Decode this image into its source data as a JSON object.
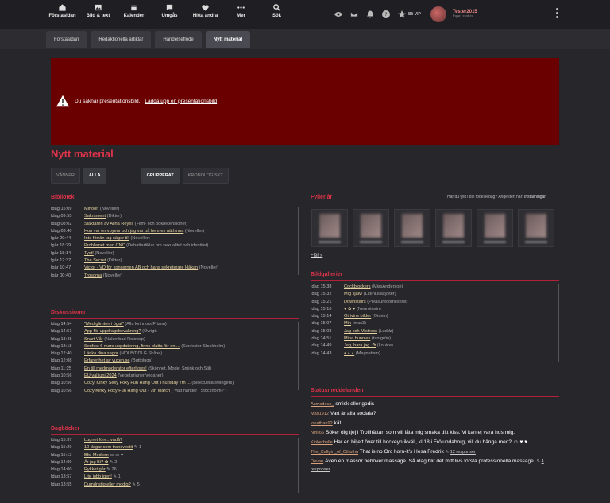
{
  "nav": [
    {
      "label": "Förstasidan",
      "icon": "home-icon"
    },
    {
      "label": "Bild & text",
      "icon": "image-icon"
    },
    {
      "label": "Kalender",
      "icon": "calendar-icon"
    },
    {
      "label": "Umgås",
      "icon": "chat-icon"
    },
    {
      "label": "Hitta andra",
      "icon": "heart-icon"
    },
    {
      "label": "Mer",
      "icon": "more-dots-icon"
    },
    {
      "label": "Sök",
      "icon": "search-icon"
    }
  ],
  "top": {
    "vip_label": "Bli VIP",
    "user_name": "Tester2015",
    "user_status": "Inget status..."
  },
  "tabs": [
    "Förstasidan",
    "Redaktionella artiklar",
    "Händelseflöde",
    "Nytt material"
  ],
  "banner": {
    "text": "Du saknar presentationsbild.",
    "link": "Ladda upp en presentationsbild"
  },
  "page_title": "Nytt material",
  "filters": {
    "friends": "VÄNNER",
    "all": "ALLA",
    "grouped": "GRUPPERAT",
    "chrono": "KRONOLOGISKT"
  },
  "bibliotek": {
    "title": "Bibliotek",
    "rows": [
      {
        "t": "Idag 15:09",
        "link": "Miftoon",
        "meta": "(Noveller)"
      },
      {
        "t": "Idag 09:55",
        "link": "Sakrament",
        "meta": "(Dikter)"
      },
      {
        "t": "Idag 08:02",
        "link": "Slaktaren av Alina Reyes",
        "meta": "(Film- och bokrecensioner)"
      },
      {
        "t": "Idag 03:40",
        "link": "Hon var en voyeur och jag var på hennes näthinna",
        "meta": "(Noveller)"
      },
      {
        "t": "Igår 20:44",
        "link": "Inte förrän jag säger till",
        "meta": "(Noveller)"
      },
      {
        "t": "Igår 18:29",
        "link": "Problemet med CNC",
        "meta": "(Debattartiklar om sexualitet och identitet)"
      },
      {
        "t": "Igår 18:14",
        "link": "Tyst!",
        "meta": "(Noveller)"
      },
      {
        "t": "Igår 12:37",
        "link": "The Secret",
        "meta": "(Dikter)"
      },
      {
        "t": "Igår 10:47",
        "link": "Victor - VD för koncernen AB och hans sekreterare Håkan",
        "meta": "(Noveller)"
      },
      {
        "t": "Igår 00:40",
        "link": "Trosorna",
        "meta": "(Noveller)"
      }
    ]
  },
  "diskussioner": {
    "title": "Diskussioner",
    "rows": [
      {
        "t": "Idag 14:54",
        "link": "\"Med glimten i ögat\"",
        "meta": "(Alla kvinnors Frizon)"
      },
      {
        "t": "Idag 14:51",
        "link": "App för uppdragsbevakning?",
        "meta": "(Övrigt)"
      },
      {
        "t": "Idag 13:48",
        "link": "Snart Vår",
        "meta": "(Nakenbad Rolstorp)"
      },
      {
        "t": "Idag 13:18",
        "link": "Sexfest 6 mars uppdatering, finns platta för en ...",
        "meta": "(Sexfester Stockholm)"
      },
      {
        "t": "Idag 12:40",
        "link": "Länka dina sagor",
        "meta": "(MDLB/DDLG Skåne)"
      },
      {
        "t": "Idag 12:08",
        "link": "Erfarenhet av vuxen.se",
        "meta": "(Buttplugs)"
      },
      {
        "t": "Idag 11:25",
        "link": "En till medmoderator efterlyses!",
        "meta": "(Skönhet, Mode, Smink och Stil)"
      },
      {
        "t": "Idag 10:56",
        "link": "EU val juni 2024",
        "meta": "(Vegetarianer/veganer)"
      },
      {
        "t": "Idag 10:56",
        "link": "Cozy, Kinky Sexy Foxy Fun Hang Out Thursday 7th ...",
        "meta": "(Bisexuella swingers)"
      },
      {
        "t": "Idag 10:56",
        "link": "Cozy Kinky Foxy Fun Hang Out - 7th March",
        "meta": "(\"Vad händer i Stockholm?\")"
      }
    ]
  },
  "dagbocker": {
    "title": "Dagböcker",
    "rows": [
      {
        "t": "Idag 15:37",
        "link": "Lugnet före...vadå?",
        "meta": ""
      },
      {
        "t": "Idag 15:29",
        "link": "10 dagar som transvestit",
        "meta": "✎ 1"
      },
      {
        "t": "Idag 15:13",
        "link": "Bfsl Mediem",
        "meta": "▭ ▭ ♥"
      },
      {
        "t": "Idag 14:09",
        "link": "Är jag Bi? ✿",
        "meta": "✎ 2"
      },
      {
        "t": "Idag 14:00",
        "link": "Rykket går",
        "meta": "✎ 26"
      },
      {
        "t": "Idag 13:57",
        "link": "Lite jobb igen!",
        "meta": "✎ 1"
      },
      {
        "t": "Idag 13:55",
        "link": "Dumdristig eller modig?",
        "meta": "✎ 5"
      }
    ]
  },
  "fyller": {
    "title": "Fyller år",
    "note": "Har du fyllt i din födelsedag? Ange den här:",
    "note_link": "Inställningar",
    "more": "Fler »"
  },
  "bildgallerier": {
    "title": "Bildgallerier",
    "rows": [
      {
        "t": "Idag 15:38",
        "link": "Cockblockers",
        "meta": "(MissAnderson)"
      },
      {
        "t": "Idag 15:32",
        "link": "Mig själv!",
        "meta": "(LitenLillasyster)"
      },
      {
        "t": "Idag 15:21",
        "link": "Downstairs",
        "meta": "(Pleasurecomesfirst)"
      },
      {
        "t": "Idag 15:16",
        "link": "♥ ✿ ♥",
        "meta": "(Neurotoxin)"
      },
      {
        "t": "Idag 15:14",
        "link": "Otrivins bilder",
        "meta": "(Otrivin)"
      },
      {
        "t": "Idag 15:07",
        "link": "Min",
        "meta": "(mas3)"
      },
      {
        "t": "Idag 15:03",
        "link": "Jag och Mistress",
        "meta": "(Luddz)"
      },
      {
        "t": "Idag 14:51",
        "link": "Mina bunnies",
        "meta": "(tantgrön)"
      },
      {
        "t": "Idag 14:49",
        "link": "Jag, bara jag. ✿",
        "meta": "(Louice)"
      },
      {
        "t": "Idag 14:43",
        "link": "◐ ◐ ◐",
        "meta": "(Magnetism)"
      }
    ]
  },
  "status": {
    "title": "Statusmeddelanden",
    "rows": [
      {
        "user": "Asmodeus_",
        "text": "smisk eller godis",
        "resp": ""
      },
      {
        "user": "Max1912",
        "text": "Vart är alla sociala?",
        "resp": ""
      },
      {
        "user": "jonathan92",
        "text": "kåt",
        "resp": ""
      },
      {
        "user": "Nihil66",
        "text": "Söker dig tjej i Trollhättan som vill låta mig smaka ditt kiss. Vi kan ej vara hos mig.",
        "resp": ""
      },
      {
        "user": "Kinkerbelle",
        "text": "Har en biljett över till hockeyn ikväll, kl 18 i Frölundaborg, vill du hänga med? ☺ ♥ ♥",
        "resp": ""
      },
      {
        "user": "The_Callgirl_of_Cthulhu",
        "text": "That is no Orc horn-it's Hesa Fredrik",
        "resp": "12 responser"
      },
      {
        "user": "Devan",
        "text": "Även en massör behöver massage. Så idag blir det mitt livs första professionella massage.",
        "resp": "4 responser"
      }
    ]
  }
}
